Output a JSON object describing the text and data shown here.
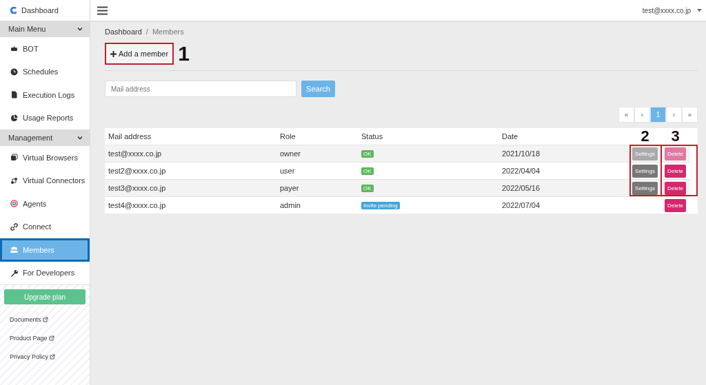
{
  "sidebar": {
    "brand": "Dashboard",
    "items": [
      {
        "kind": "section",
        "label": "Main Menu",
        "expanded": true
      },
      {
        "kind": "link",
        "label": "BOT",
        "selected": false
      },
      {
        "kind": "link",
        "label": "Schedules",
        "selected": false
      },
      {
        "kind": "link",
        "label": "Execution Logs",
        "selected": false
      },
      {
        "kind": "link",
        "label": "Usage Reports",
        "selected": false
      },
      {
        "kind": "section",
        "label": "Management",
        "expanded": true
      },
      {
        "kind": "link",
        "label": "Virtual Browsers",
        "selected": false
      },
      {
        "kind": "link",
        "label": "Virtual Connectors",
        "selected": false
      },
      {
        "kind": "link",
        "label": "Agents",
        "selected": false
      },
      {
        "kind": "link",
        "label": "Connect",
        "selected": false
      },
      {
        "kind": "link",
        "label": "Members",
        "selected": true
      },
      {
        "kind": "link",
        "label": "For Developers",
        "selected": false
      }
    ],
    "upgrade_button": "Upgrade plan",
    "external_links": [
      "Documents",
      "Product Page",
      "Privacy Policy"
    ]
  },
  "topbar": {
    "user": "test@xxxx.co.jp"
  },
  "breadcrumb": [
    "Dashboard",
    "/",
    "Members"
  ],
  "add_button": "Add a member",
  "search": {
    "placeholder": "Mail address",
    "button": "Search"
  },
  "pagination": [
    {
      "label": "«",
      "selected": false
    },
    {
      "label": "‹",
      "selected": false
    },
    {
      "label": "1",
      "selected": true
    },
    {
      "label": "›",
      "selected": false
    },
    {
      "label": "»",
      "selected": false
    }
  ],
  "table": {
    "columns": [
      "Mail address",
      "Role",
      "Status",
      "Date"
    ],
    "rows": [
      {
        "email": "test@xxxx.co.jp",
        "role": "owner",
        "status": {
          "text": "OK",
          "kind": "ok"
        },
        "date": "2021/10/18",
        "settings": {
          "label": "Settings",
          "disabled": true
        },
        "delete": {
          "label": "Delete",
          "disabled": true
        }
      },
      {
        "email": "test2@xxxx.co.jp",
        "role": "user",
        "status": {
          "text": "OK",
          "kind": "ok"
        },
        "date": "2022/04/04",
        "settings": {
          "label": "Settings",
          "disabled": false
        },
        "delete": {
          "label": "Delete",
          "disabled": false
        }
      },
      {
        "email": "test3@xxxx.co.jp",
        "role": "payer",
        "status": {
          "text": "OK",
          "kind": "ok"
        },
        "date": "2022/05/16",
        "settings": {
          "label": "Settings",
          "disabled": false
        },
        "delete": {
          "label": "Delete",
          "disabled": false
        }
      },
      {
        "email": "test4@xxxx.co.jp",
        "role": "admin",
        "status": {
          "text": "Invite pending",
          "kind": "pending"
        },
        "date": "2022/07/04",
        "delete": {
          "label": "Delete",
          "disabled": false
        }
      }
    ]
  },
  "annotations": [
    "1",
    "2",
    "3"
  ]
}
